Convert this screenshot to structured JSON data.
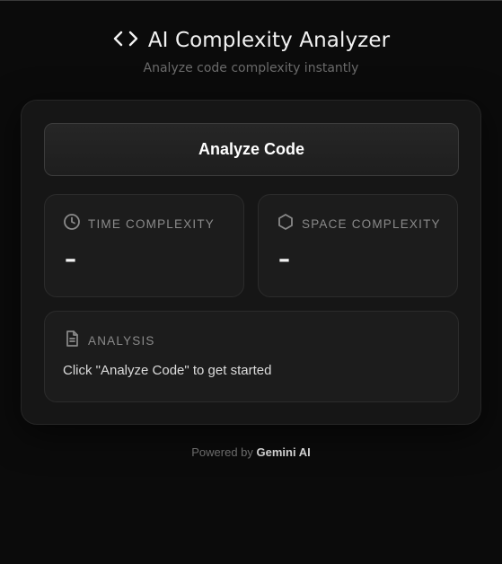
{
  "header": {
    "title": "AI Complexity Analyzer",
    "subtitle": "Analyze code complexity instantly",
    "icon": "code-brackets-icon"
  },
  "actions": {
    "analyze_label": "Analyze Code"
  },
  "time_card": {
    "label": "TIME COMPLEXITY",
    "value": "–",
    "icon": "clock-icon"
  },
  "space_card": {
    "label": "SPACE COMPLEXITY",
    "value": "–",
    "icon": "hexagon-icon"
  },
  "analysis_card": {
    "label": "ANALYSIS",
    "text": "Click \"Analyze Code\" to get started",
    "icon": "document-icon"
  },
  "footer": {
    "prefix": "Powered by",
    "brand": "Gemini AI"
  },
  "colors": {
    "background": "#0b0b0b",
    "panel": "#161616",
    "card": "#1c1c1c",
    "muted_text": "#8a8a8a"
  }
}
